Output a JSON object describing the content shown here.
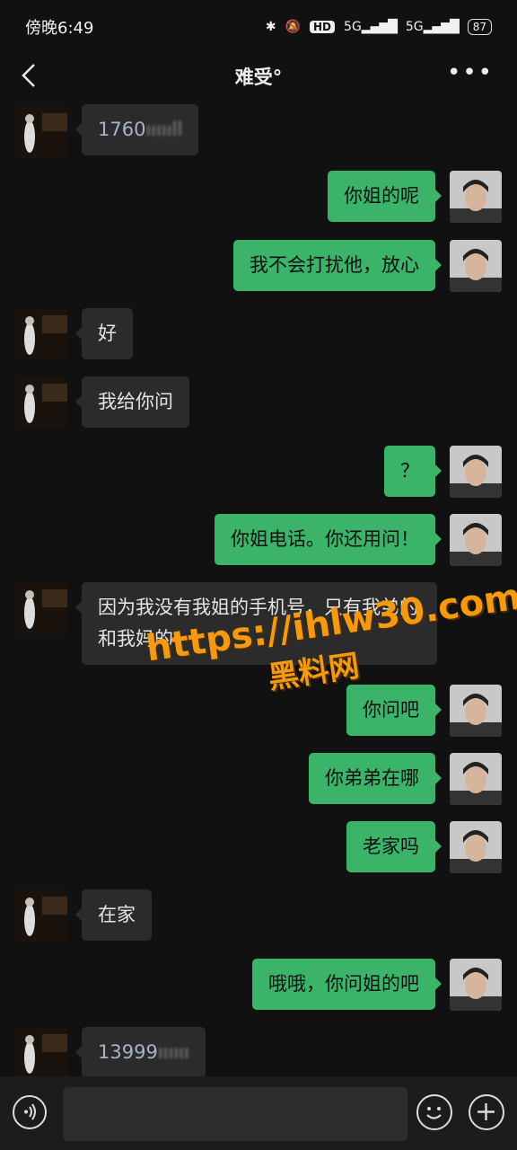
{
  "status": {
    "time": "傍晚6:49",
    "hd": "HD",
    "net1": "5G",
    "net2": "5G",
    "battery": "87"
  },
  "header": {
    "title": "难受°"
  },
  "messages": [
    {
      "side": "left",
      "text": "1760",
      "blurred": "ıııııll"
    },
    {
      "side": "right",
      "text": "你姐的呢"
    },
    {
      "side": "right",
      "text": "我不会打扰他，放心"
    },
    {
      "side": "left",
      "text": "好"
    },
    {
      "side": "left",
      "text": "我给你问"
    },
    {
      "side": "right",
      "text": "？"
    },
    {
      "side": "right",
      "text": "你姐电话。你还用问！"
    },
    {
      "side": "left",
      "text": "因为我没有我姐的手机号，只有我弟的和我妈的"
    },
    {
      "side": "right",
      "text": "你问吧"
    },
    {
      "side": "right",
      "text": "你弟弟在哪"
    },
    {
      "side": "right",
      "text": "老家吗"
    },
    {
      "side": "left",
      "text": "在家"
    },
    {
      "side": "right",
      "text": "哦哦，你问姐的吧"
    },
    {
      "side": "left",
      "text": "13999",
      "blurred": "ıııııı"
    }
  ],
  "watermark": {
    "url": "https://ihlw30.com",
    "name": "黑料网"
  },
  "colors": {
    "sent_bubble": "#3bb46a",
    "received_bubble": "#2b2b2b",
    "background": "#111111"
  }
}
